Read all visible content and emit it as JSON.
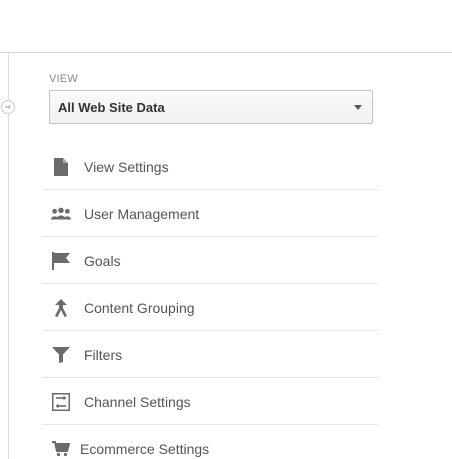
{
  "view_section": {
    "label": "VIEW",
    "selected_view": "All Web Site Data"
  },
  "menu": {
    "items": [
      {
        "label": "View Settings",
        "icon": "document-icon"
      },
      {
        "label": "User Management",
        "icon": "users-icon"
      },
      {
        "label": "Goals",
        "icon": "flag-icon"
      },
      {
        "label": "Content Grouping",
        "icon": "merge-icon"
      },
      {
        "label": "Filters",
        "icon": "filter-icon"
      },
      {
        "label": "Channel Settings",
        "icon": "channel-settings-icon"
      },
      {
        "label": "Ecommerce Settings",
        "icon": "cart-icon"
      }
    ]
  },
  "colors": {
    "icon": "#6b6b6b",
    "text": "#555555",
    "divider": "#e6e6e6"
  }
}
